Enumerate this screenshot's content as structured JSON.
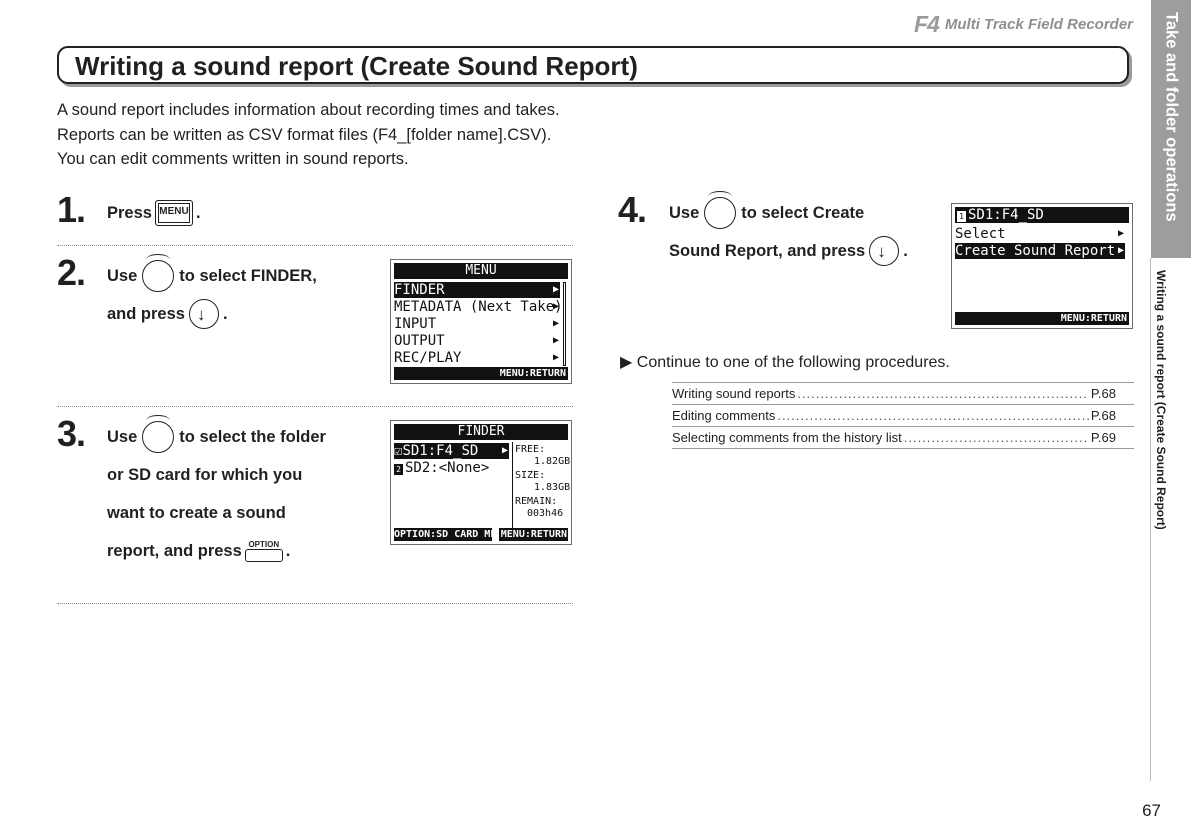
{
  "header": {
    "logo": "F4",
    "product": "Multi Track Field Recorder"
  },
  "title": "Writing a sound report (Create Sound Report)",
  "intro": [
    "A sound report includes information about recording times and takes.",
    "Reports can be written as CSV format files (F4_[folder name].CSV).",
    "You can edit comments written in sound reports."
  ],
  "side_tab": {
    "section": "Take and folder operations",
    "subsection": "Writing a sound report (Create Sound Report)"
  },
  "steps": {
    "s1": {
      "num": "1.",
      "pre": "Press",
      "key": "MENU",
      "post": "."
    },
    "s2": {
      "num": "2.",
      "line1_pre": "Use",
      "line1_post": "to select FINDER,",
      "line2_pre": "and press",
      "line2_post": "."
    },
    "s3": {
      "num": "3.",
      "line1_pre": "Use",
      "line1_post": "to select the folder",
      "line2": "or SD card for which you",
      "line3": "want to create a sound",
      "line4_pre": "report, and press",
      "key": "OPTION",
      "line4_post": "."
    },
    "s4": {
      "num": "4.",
      "line1_pre": "Use",
      "line1_post": "to select Create",
      "line2_pre": "Sound Report, and press",
      "line2_post": "."
    }
  },
  "screens": {
    "menu": {
      "title": "MENU",
      "items": [
        "FINDER",
        "METADATA (Next Take)",
        "INPUT",
        "OUTPUT",
        "REC/PLAY"
      ],
      "footer": "MENU:RETURN"
    },
    "finder": {
      "title": "FINDER",
      "items": [
        "SD1:F4_SD",
        "SD2:<None>"
      ],
      "free_label": "FREE:",
      "free_value": "1.82GB",
      "size_label": "SIZE:",
      "size_value": "1.83GB",
      "remain_label": "REMAIN:",
      "remain_value": "003h46",
      "footer_left": "OPTION:SD CARD MENU",
      "footer_right": "MENU:RETURN"
    },
    "report": {
      "title": "SD1:F4_SD",
      "items": [
        "Select",
        "Create Sound Report"
      ],
      "footer": "MENU:RETURN"
    }
  },
  "procedures": {
    "intro": "Continue to one of the following procedures.",
    "items": [
      {
        "label": "Writing sound reports",
        "page": "P.68"
      },
      {
        "label": "Editing comments",
        "page": "P.68"
      },
      {
        "label": "Selecting comments from the history list",
        "page": "P.69"
      }
    ]
  },
  "page_number": "67"
}
